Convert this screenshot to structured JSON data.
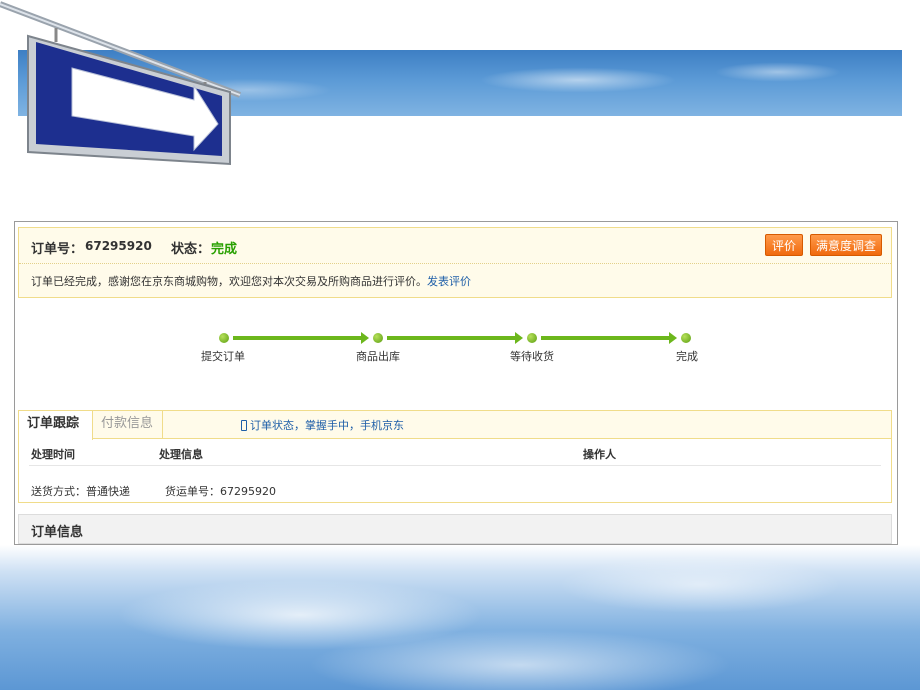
{
  "order": {
    "order_no_label": "订单号：",
    "order_no": "67295920",
    "status_label": "状态：",
    "status_value": "完成",
    "review_button": "评价",
    "survey_button": "满意度调查",
    "message": "订单已经完成，感谢您在京东商城购物，欢迎您对本次交易及所购商品进行评价。",
    "message_link": "发表评价"
  },
  "progress": {
    "steps": [
      "提交订单",
      "商品出库",
      "等待收货",
      "完成"
    ]
  },
  "tracking": {
    "tabs": [
      "订单跟踪",
      "付款信息"
    ],
    "mobile_link": "订单状态，掌握手中，手机京东",
    "columns": [
      "处理时间",
      "处理信息",
      "操作人"
    ],
    "shipping_method": "送货方式：普通快递",
    "waybill": "货运单号：67295920"
  },
  "order_info": {
    "title": "订单信息"
  },
  "colors": {
    "status_green": "#28a000",
    "button_orange": "#f06a0e",
    "progress_green": "#6cb71c",
    "link_blue": "#1f5fa8"
  }
}
